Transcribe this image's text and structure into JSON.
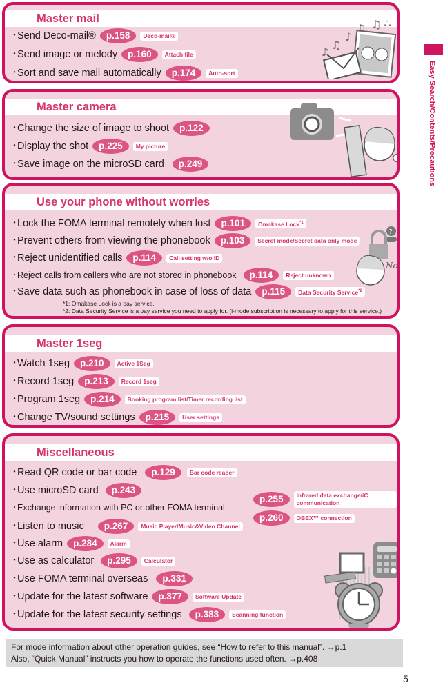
{
  "sidebar": {
    "label": "Easy Search/Contents/Precautions",
    "accent_color": "#d0135f"
  },
  "sections": [
    {
      "title": "Master mail",
      "items": [
        {
          "text": "Send Deco-mail®",
          "page": "p.158",
          "tag": "Deco-mail®"
        },
        {
          "text": "Send image or melody",
          "page": "p.160",
          "tag": "Attach file"
        },
        {
          "text": "Sort and save mail automatically",
          "page": "p.174",
          "tag": "Auto-sort"
        }
      ],
      "illustration": "mail-music-photo-illustration"
    },
    {
      "title": "Master camera",
      "items": [
        {
          "text": "Change the size of image to shoot",
          "page": "p.122",
          "tag": ""
        },
        {
          "text": "Display the shot",
          "page": "p.225",
          "tag": "My picture"
        },
        {
          "text": "Save image on the microSD card",
          "page": "p.249",
          "tag": ""
        }
      ],
      "illustration": "camera-phone-illustration"
    },
    {
      "title": "Use your phone without worries",
      "items": [
        {
          "text": "Lock the FOMA terminal remotely when lost",
          "page": "p.101",
          "tag": "Omakase Lock",
          "tag_sup": "*1"
        },
        {
          "text": "Prevent others from viewing the phonebook",
          "page": "p.103",
          "tag": "Secret mode/Secret data only mode"
        },
        {
          "text": "Reject unidentified calls",
          "page": "p.114",
          "tag": "Call setting w/o ID"
        },
        {
          "text": "Reject calls from callers who are not stored in phonebook",
          "page": "p.114",
          "tag": "Reject unknown"
        },
        {
          "text": "Save data such as phonebook in case of loss of data",
          "page": "p.115",
          "tag": "Data Security Service",
          "tag_sup": "*2"
        }
      ],
      "notes": [
        "*1: Omakase Lock is a pay service.",
        "*2: Data Security Service is a pay service you need to apply for. (i-mode subscription is necessary to apply for this service.)"
      ],
      "illustration": "lock-girl-no-illustration"
    },
    {
      "title": "Master 1seg",
      "items": [
        {
          "text": "Watch 1seg",
          "page": "p.210",
          "tag": "Active 1Seg"
        },
        {
          "text": "Record 1seg",
          "page": "p.213",
          "tag": "Record 1seg"
        },
        {
          "text": "Program 1seg",
          "page": "p.214",
          "tag": "Booking program list/Timer recording list"
        },
        {
          "text": "Change TV/sound settings",
          "page": "p.215",
          "tag": "User settings"
        }
      ]
    },
    {
      "title": "Miscellaneous",
      "items": [
        {
          "text": "Read QR code or bar code",
          "page": "p.129",
          "tag": "Bar code reader"
        },
        {
          "text": "Use microSD card",
          "page": "p.243",
          "tag": ""
        },
        {
          "text": "Exchange information with PC or other FOMA terminal",
          "page": "",
          "tag": ""
        },
        {
          "text": "Listen to music",
          "page": "p.267",
          "tag": "Music Player/Music&Video Channel"
        },
        {
          "text": "Use alarm",
          "page": "p.284",
          "tag": "Alarm"
        },
        {
          "text": "Use as calculator",
          "page": "p.295",
          "tag": "Calculator"
        },
        {
          "text": "Use FOMA terminal overseas",
          "page": "p.331",
          "tag": ""
        },
        {
          "text": "Update for the latest software",
          "page": "p.377",
          "tag": "Software Update"
        },
        {
          "text": "Update for the latest security settings",
          "page": "p.383",
          "tag": "Scanning function"
        }
      ],
      "exchange_refs": [
        {
          "page": "p.255",
          "tag": "Infrared data exchange/iC communication"
        },
        {
          "page": "p.260",
          "tag": "OBEX™ connection"
        }
      ],
      "illustration": "pc-calculator-alarm-illustration"
    }
  ],
  "footer": {
    "line1": "For mode information about other operation guides, see “How to refer to this manual”. →p.1",
    "line2": "Also, “Quick Manual” instructs you how to operate the functions used often. →p.408"
  },
  "page_number": "5",
  "colors": {
    "frame": "#d0135f",
    "panel": "#f3d3de",
    "page_pill": "#dc5484",
    "title": "#d6336f",
    "footer_bg": "#d9d9d9"
  },
  "bullet": "･"
}
